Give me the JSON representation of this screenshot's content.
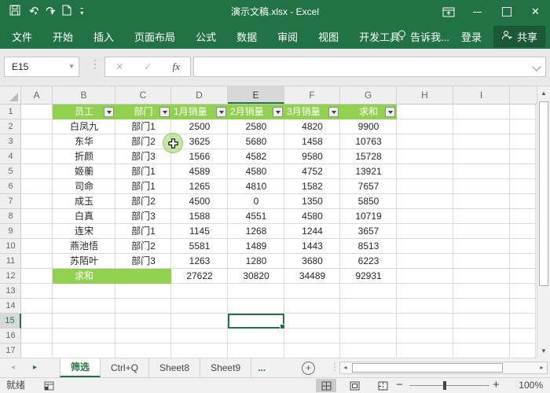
{
  "title_bar": {
    "title": "演示文稿.xlsx - Excel"
  },
  "ribbon": {
    "tabs": [
      "文件",
      "开始",
      "插入",
      "页面布局",
      "公式",
      "数据",
      "审阅",
      "视图",
      "开发工具"
    ],
    "tell_me": "告诉我...",
    "sign_in": "登录",
    "share": "共享"
  },
  "formula_bar": {
    "name_box": "E15",
    "fx_label": "fx",
    "formula_value": ""
  },
  "grid": {
    "column_letters": [
      "A",
      "B",
      "C",
      "D",
      "E",
      "F",
      "G",
      "H",
      "I"
    ],
    "row_numbers": [
      1,
      2,
      3,
      4,
      5,
      6,
      7,
      8,
      9,
      10,
      11,
      12,
      13,
      14,
      15,
      16,
      17
    ],
    "selected_cell_ref": "E15",
    "selected_column": "E",
    "selected_row": 15
  },
  "table": {
    "headers": [
      "员工",
      "部门",
      "1月销量",
      "2月销量",
      "3月销量",
      "求和"
    ],
    "rows": [
      [
        "白凤九",
        "部门1",
        "2500",
        "2580",
        "4820",
        "9900"
      ],
      [
        "东华",
        "部门2",
        "3625",
        "5680",
        "1458",
        "10763"
      ],
      [
        "折颜",
        "部门3",
        "1566",
        "4582",
        "9580",
        "15728"
      ],
      [
        "姬蘅",
        "部门1",
        "4589",
        "4580",
        "4752",
        "13921"
      ],
      [
        "司命",
        "部门1",
        "1265",
        "4810",
        "1582",
        "7657"
      ],
      [
        "成玉",
        "部门2",
        "4500",
        "0",
        "1350",
        "5850"
      ],
      [
        "白真",
        "部门3",
        "1588",
        "4551",
        "4580",
        "10719"
      ],
      [
        "连宋",
        "部门1",
        "1145",
        "1268",
        "1244",
        "3657"
      ],
      [
        "燕池悟",
        "部门2",
        "5581",
        "1489",
        "1443",
        "8513"
      ],
      [
        "苏陌叶",
        "部门3",
        "1263",
        "1280",
        "3680",
        "6223"
      ]
    ],
    "total_label": "求和",
    "total_values": [
      "27622",
      "30820",
      "34489",
      "92931"
    ]
  },
  "sheet_tabs": {
    "active_tab": "筛选",
    "other_tabs": [
      "Ctrl+Q",
      "Sheet8",
      "Sheet9"
    ],
    "overflow_indicator": "..."
  },
  "status_bar": {
    "ready": "就绪",
    "zoom": "100%"
  },
  "colors": {
    "excel_green": "#217346",
    "table_header_green": "#92D050",
    "selection_border": "#217346"
  }
}
